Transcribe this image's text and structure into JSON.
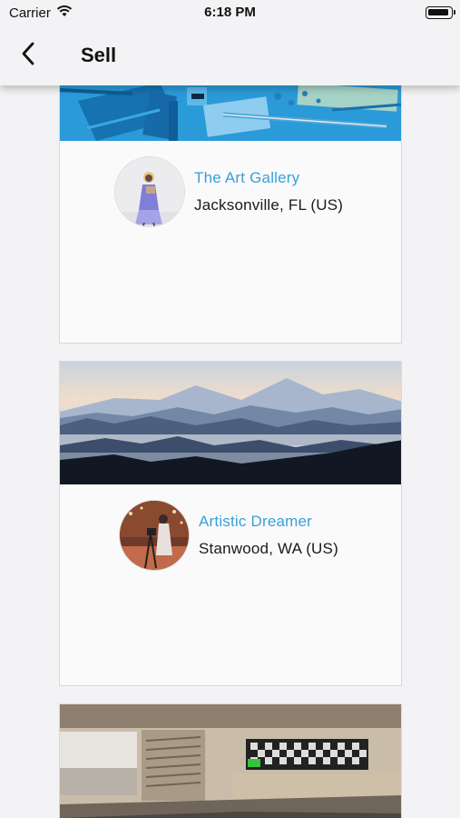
{
  "status_bar": {
    "carrier": "Carrier",
    "time": "6:18 PM",
    "icons": [
      "wifi-icon",
      "battery-icon"
    ]
  },
  "nav_bar": {
    "title": "Sell",
    "back_icon": "chevron-left-icon"
  },
  "sellers": [
    {
      "name": "The Art Gallery",
      "location": "Jacksonville, FL (US)",
      "banner": "blue art supplies",
      "avatar": "person in purple dress"
    },
    {
      "name": "Artistic Dreamer",
      "location": "Stanwood, WA (US)",
      "banner": "misty blue mountains",
      "avatar": "person with easel"
    },
    {
      "name": "",
      "location": "",
      "banner": "interior room with checkered artwork",
      "avatar": ""
    }
  ],
  "colors": {
    "accent": "#3a9fd8",
    "background": "#f3f3f5",
    "card": "#fafafa"
  }
}
